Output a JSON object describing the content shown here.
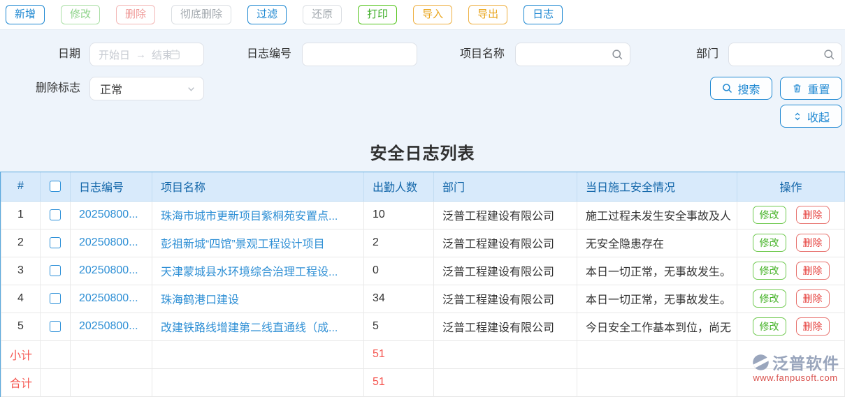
{
  "toolbar": {
    "buttons": [
      "新增",
      "修改",
      "删除",
      "彻底删除",
      "过滤",
      "还原",
      "打印",
      "导入",
      "导出",
      "日志"
    ]
  },
  "filters": {
    "date": {
      "label": "日期",
      "start_placeholder": "开始日",
      "arrow": "→",
      "end_placeholder": "结束"
    },
    "log_no": {
      "label": "日志编号",
      "value": ""
    },
    "project": {
      "label": "项目名称",
      "value": ""
    },
    "dept": {
      "label": "部门",
      "value": ""
    },
    "delete_flag": {
      "label": "删除标志",
      "value": "正常"
    },
    "search_label": "搜索",
    "reset_label": "重置",
    "collapse_label": "收起"
  },
  "page_title": "安全日志列表",
  "table": {
    "headers": {
      "index": "#",
      "log_no": "日志编号",
      "project": "项目名称",
      "attendance": "出勤人数",
      "dept": "部门",
      "safety": "当日施工安全情况",
      "actions": "操作"
    },
    "actions": {
      "edit": "修改",
      "delete": "删除"
    },
    "rows": [
      {
        "no": "1",
        "log_no": "20250800...",
        "project": "珠海市城市更新项目紫桐苑安置点...",
        "attendance": "10",
        "dept": "泛普工程建设有限公司",
        "safety": "施工过程未发生安全事故及人"
      },
      {
        "no": "2",
        "log_no": "20250800...",
        "project": "彭祖新城“四馆”景观工程设计项目",
        "attendance": "2",
        "dept": "泛普工程建设有限公司",
        "safety": "无安全隐患存在"
      },
      {
        "no": "3",
        "log_no": "20250800...",
        "project": "天津蒙城县水环境综合治理工程设...",
        "attendance": "0",
        "dept": "泛普工程建设有限公司",
        "safety": "本日一切正常，无事故发生。"
      },
      {
        "no": "4",
        "log_no": "20250800...",
        "project": "珠海鹤港口建设",
        "attendance": "34",
        "dept": "泛普工程建设有限公司",
        "safety": "本日一切正常，无事故发生。"
      },
      {
        "no": "5",
        "log_no": "20250800...",
        "project": "改建铁路线增建第二线直通线（成...",
        "attendance": "5",
        "dept": "泛普工程建设有限公司",
        "safety": "今日安全工作基本到位，尚无"
      }
    ],
    "subtotal": {
      "label": "小计",
      "attendance": "51"
    },
    "total": {
      "label": "合计",
      "attendance": "51"
    }
  },
  "watermark": {
    "brand": "泛普软件",
    "site": "www.fanpusoft.com"
  },
  "colors": {
    "primary_blue": "#1e88d2",
    "header_bg": "#d8eafb",
    "header_text": "#1266a9",
    "link": "#2e8fd5",
    "green": "#52c41a",
    "orange": "#eeb042",
    "red": "#e64340",
    "totals_red": "#f5554f",
    "filter_bg": "#eef4fb"
  }
}
